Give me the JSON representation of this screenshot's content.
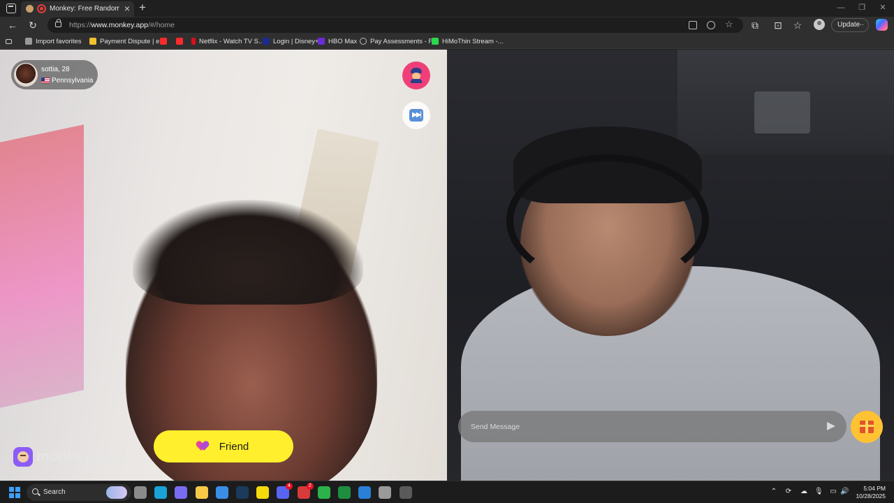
{
  "browser": {
    "tab_title": "Monkey: Free Random Video",
    "url_protocol": "https://",
    "url_host": "www.monkey.app",
    "url_path": "/#/home",
    "update_label": "Update",
    "bookmarks": [
      {
        "label": "Import favorites",
        "color": "#9a9a9a"
      },
      {
        "label": "Payment Dispute | e...",
        "color": "#f2c12e"
      },
      {
        "label": "",
        "color": "#ff2a2a"
      },
      {
        "label": "",
        "color": "#ff2a2a"
      },
      {
        "label": "Netflix - Watch TV S...",
        "color": "#d80f1a"
      },
      {
        "label": "Login | Disney+",
        "color": "#1b2a8f"
      },
      {
        "label": "HBO Max",
        "color": "#6b2bd9"
      },
      {
        "label": "Pay Assessments - F...",
        "color": "#bdbdbd"
      },
      {
        "label": "HiMoThin Stream -...",
        "color": "#2bd84a"
      }
    ]
  },
  "app": {
    "peer": {
      "name_age": "sottia, 28",
      "location": "Pennsylvania"
    },
    "report_icon": "police-officer-icon",
    "skip_icon": "next-track-icon",
    "friend_label": "Friend",
    "brand": "monkey.cool",
    "chat_placeholder": "Send Message",
    "gift_icon": "gift-icon",
    "accent_pink": "#f03f78",
    "accent_yellow": "#ffef2c"
  },
  "taskbar": {
    "search_label": "Search",
    "apps": [
      {
        "name": "task-view",
        "color": "#8a8a8a",
        "badge": ""
      },
      {
        "name": "edge",
        "color": "#1aa1d6",
        "badge": ""
      },
      {
        "name": "copilot",
        "color": "#7a6cf0",
        "badge": ""
      },
      {
        "name": "file-explorer",
        "color": "#f7c948",
        "badge": ""
      },
      {
        "name": "store",
        "color": "#3a8ee6",
        "badge": ""
      },
      {
        "name": "steam",
        "color": "#1b3a5c",
        "badge": ""
      },
      {
        "name": "sticky-notes",
        "color": "#f5d90a",
        "badge": ""
      },
      {
        "name": "discord",
        "color": "#5865f2",
        "badge": "4"
      },
      {
        "name": "app-red",
        "color": "#d63a3a",
        "badge": "2"
      },
      {
        "name": "xbox",
        "color": "#2bb34a",
        "badge": ""
      },
      {
        "name": "app-green",
        "color": "#1e8e3e",
        "badge": ""
      },
      {
        "name": "vscode",
        "color": "#2a7fd6",
        "badge": ""
      },
      {
        "name": "app-gray",
        "color": "#9a9a9a",
        "badge": ""
      },
      {
        "name": "settings-app",
        "color": "#5a5a5a",
        "badge": ""
      }
    ],
    "time": "5:04 PM",
    "date": "10/28/2025"
  }
}
